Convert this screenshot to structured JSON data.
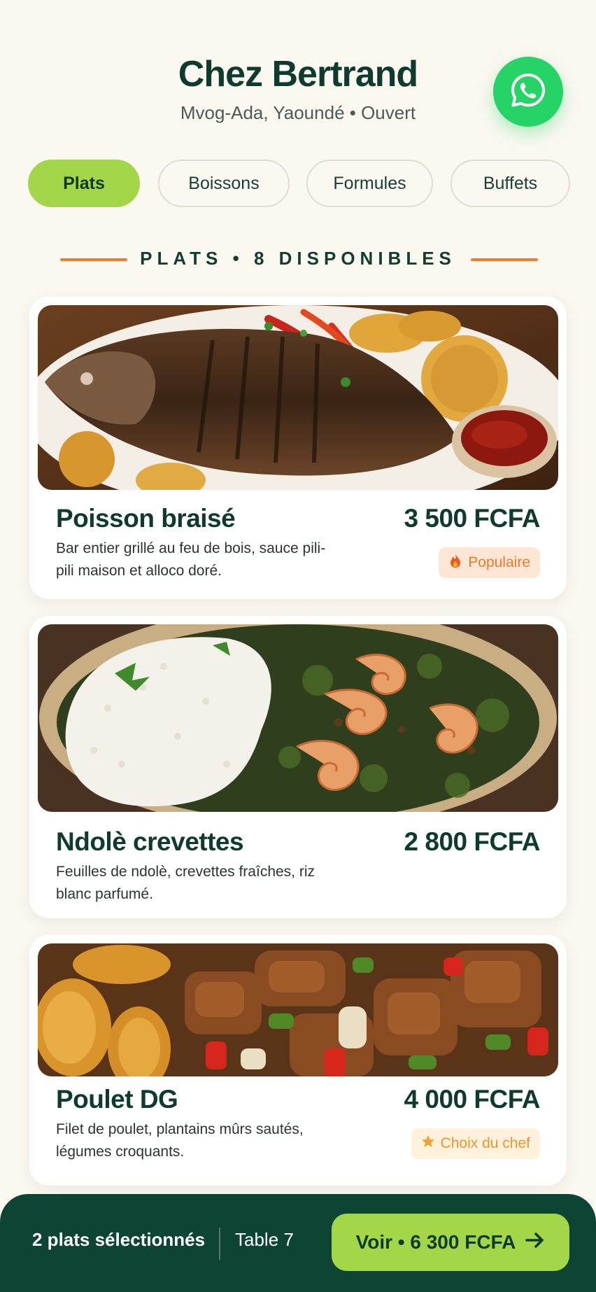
{
  "header": {
    "title": "Chez Bertrand",
    "subtitle": "Mvog-Ada, Yaoundé • Ouvert",
    "whatsapp_icon": "whatsapp-icon",
    "whatsapp_color": "#25d366"
  },
  "tabs": [
    {
      "label": "Plats",
      "active": true
    },
    {
      "label": "Boissons",
      "active": false
    },
    {
      "label": "Formules",
      "active": false
    },
    {
      "label": "Buffets",
      "active": false
    }
  ],
  "section": {
    "title": "PLATS • 8 DISPONIBLES",
    "accent_color": "#ef7b2d"
  },
  "dishes": [
    {
      "name": "Poisson braisé",
      "price": "3 500 FCFA",
      "description": "Bar entier grillé au feu de bois, sauce pili-pili maison et alloco doré.",
      "badge": {
        "icon": "fire-icon",
        "label": "Populaire"
      }
    },
    {
      "name": "Ndolè crevettes",
      "price": "2 800 FCFA",
      "description": "Feuilles de ndolè, crevettes fraîches, riz blanc parfumé."
    },
    {
      "name": "Poulet DG",
      "price": "4 000 FCFA",
      "description": "Filet de poulet, plantains mûrs sautés, légumes croquants.",
      "badge": {
        "icon": "star-icon",
        "label": "Choix du chef"
      }
    }
  ],
  "cart_bar": {
    "count_label": "2 plats sélectionnés",
    "table_label": "Table 7",
    "cta_label": "Voir • 6 300 FCFA",
    "cta_icon": "arrow-right-icon",
    "background": "#0d4433",
    "cta_color": "#a4d64a"
  }
}
